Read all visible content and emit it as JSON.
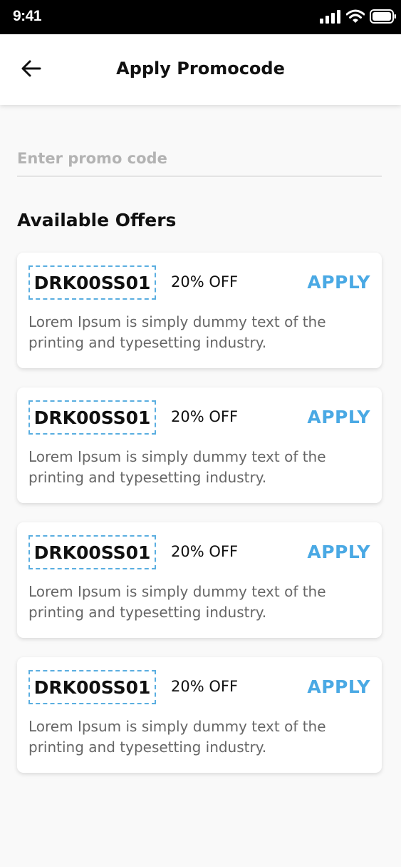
{
  "status_bar": {
    "time": "9:41",
    "icons": [
      "signal-icon",
      "wifi-icon",
      "battery-icon"
    ]
  },
  "header": {
    "back_icon": "arrow-left-icon",
    "title": "Apply Promocode"
  },
  "promo_input": {
    "placeholder": "Enter promo code",
    "value": ""
  },
  "offers_section": {
    "title": "Available Offers"
  },
  "offers": [
    {
      "code": "DRK00SS01",
      "discount": "20% OFF",
      "apply_label": "APPLY",
      "description": "Lorem Ipsum is simply dummy text of the printing and typesetting industry."
    },
    {
      "code": "DRK00SS01",
      "discount": "20% OFF",
      "apply_label": "APPLY",
      "description": "Lorem Ipsum is simply dummy text of the printing and typesetting industry."
    },
    {
      "code": "DRK00SS01",
      "discount": "20% OFF",
      "apply_label": "APPLY",
      "description": "Lorem Ipsum is simply dummy text of the printing and typesetting industry."
    },
    {
      "code": "DRK00SS01",
      "discount": "20% OFF",
      "apply_label": "APPLY",
      "description": "Lorem Ipsum is simply dummy text of the printing and typesetting industry."
    }
  ],
  "colors": {
    "accent": "#4aa9e4",
    "dashed_border": "#5aaee0",
    "background": "#f9f9f9"
  }
}
